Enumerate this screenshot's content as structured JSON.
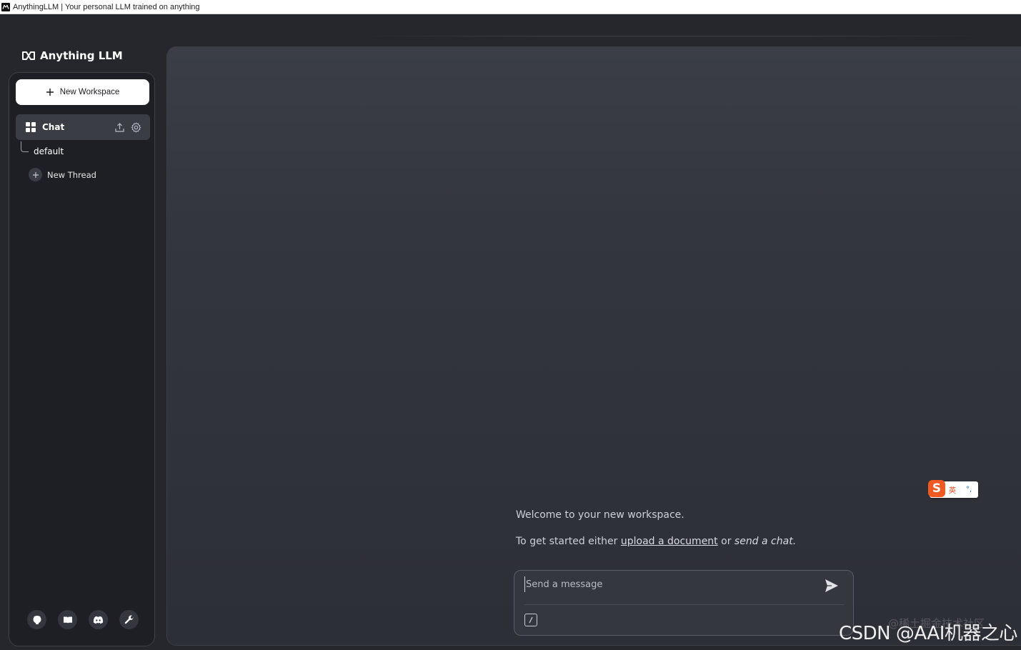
{
  "window": {
    "title": "AnythingLLM | Your personal LLM trained on anything"
  },
  "brand": {
    "name": "Anything LLM"
  },
  "sidebar": {
    "new_workspace_label": "New Workspace",
    "workspace": {
      "name": "Chat"
    },
    "threads": [
      {
        "label": "default"
      }
    ],
    "new_thread_label": "New Thread",
    "footer_icons": [
      "github-icon",
      "docs-book-icon",
      "discord-icon",
      "settings-wrench-icon"
    ]
  },
  "main": {
    "welcome": "Welcome to your new workspace.",
    "get_started": {
      "prefix": "To get started either",
      "upload_link": "upload a document",
      "middle": "or",
      "send_text": "send a chat.",
      "suffix": ""
    },
    "composer": {
      "placeholder": "Send a message",
      "value": ""
    }
  },
  "ime": {
    "logo": "S",
    "lang": "英",
    "punct": "°,"
  },
  "watermarks": {
    "faint": "@稀土掘金技术社区",
    "main": "CSDN @AAI机器之心"
  },
  "colors": {
    "background": "#25272d",
    "sidebar": "#1d1f24",
    "accent_button": "#ffffff",
    "selected_item": "#3a3d44"
  }
}
